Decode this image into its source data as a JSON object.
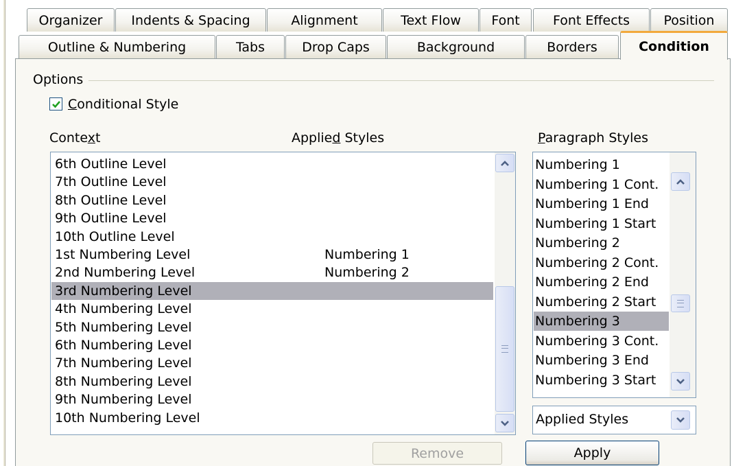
{
  "tabs_row1": [
    "Organizer",
    "Indents & Spacing",
    "Alignment",
    "Text Flow",
    "Font",
    "Font Effects",
    "Position"
  ],
  "tabs_row2": [
    "Outline & Numbering",
    "Tabs",
    "Drop Caps",
    "Background",
    "Borders",
    "Condition"
  ],
  "active_tab": "Condition",
  "options": {
    "label": "Options",
    "conditional_style": {
      "label_underlined": "C",
      "label_rest": "onditional Style",
      "checked": true
    }
  },
  "headers": {
    "context_pre": "Conte",
    "context_u": "x",
    "context_post": "t",
    "applied_pre": "Applie",
    "applied_u": "d",
    "applied_post": " Styles",
    "para_u": "P",
    "para_post": "aragraph Styles"
  },
  "context_rows": [
    {
      "context": "6th Outline Level",
      "applied": ""
    },
    {
      "context": "7th Outline Level",
      "applied": ""
    },
    {
      "context": "8th Outline Level",
      "applied": ""
    },
    {
      "context": "9th Outline Level",
      "applied": ""
    },
    {
      "context": "10th Outline Level",
      "applied": ""
    },
    {
      "context": "1st Numbering Level",
      "applied": "Numbering 1"
    },
    {
      "context": "2nd Numbering Level",
      "applied": "Numbering 2"
    },
    {
      "context": "3rd Numbering Level",
      "applied": "",
      "selected": true
    },
    {
      "context": "4th Numbering Level",
      "applied": ""
    },
    {
      "context": "5th Numbering Level",
      "applied": ""
    },
    {
      "context": "6th Numbering Level",
      "applied": ""
    },
    {
      "context": "7th Numbering Level",
      "applied": ""
    },
    {
      "context": "8th Numbering Level",
      "applied": ""
    },
    {
      "context": "9th Numbering Level",
      "applied": ""
    },
    {
      "context": "10th Numbering Level",
      "applied": ""
    }
  ],
  "paragraph_styles": [
    "Numbering 1",
    "Numbering 1 Cont.",
    "Numbering 1 End",
    "Numbering 1 Start",
    "Numbering 2",
    "Numbering 2 Cont.",
    "Numbering 2 End",
    "Numbering 2 Start",
    "Numbering 3",
    "Numbering 3 Cont.",
    "Numbering 3 End",
    "Numbering 3 Start"
  ],
  "selected_paragraph_style": "Numbering 3",
  "filter_select": {
    "value": "Applied Styles"
  },
  "buttons": {
    "remove": "Remove",
    "apply": "Apply"
  },
  "colors": {
    "tab_accent": "#f2a93b",
    "selection": "#b0b0b8",
    "panel_bg": "#f9f8f3",
    "check": "#21a121"
  }
}
